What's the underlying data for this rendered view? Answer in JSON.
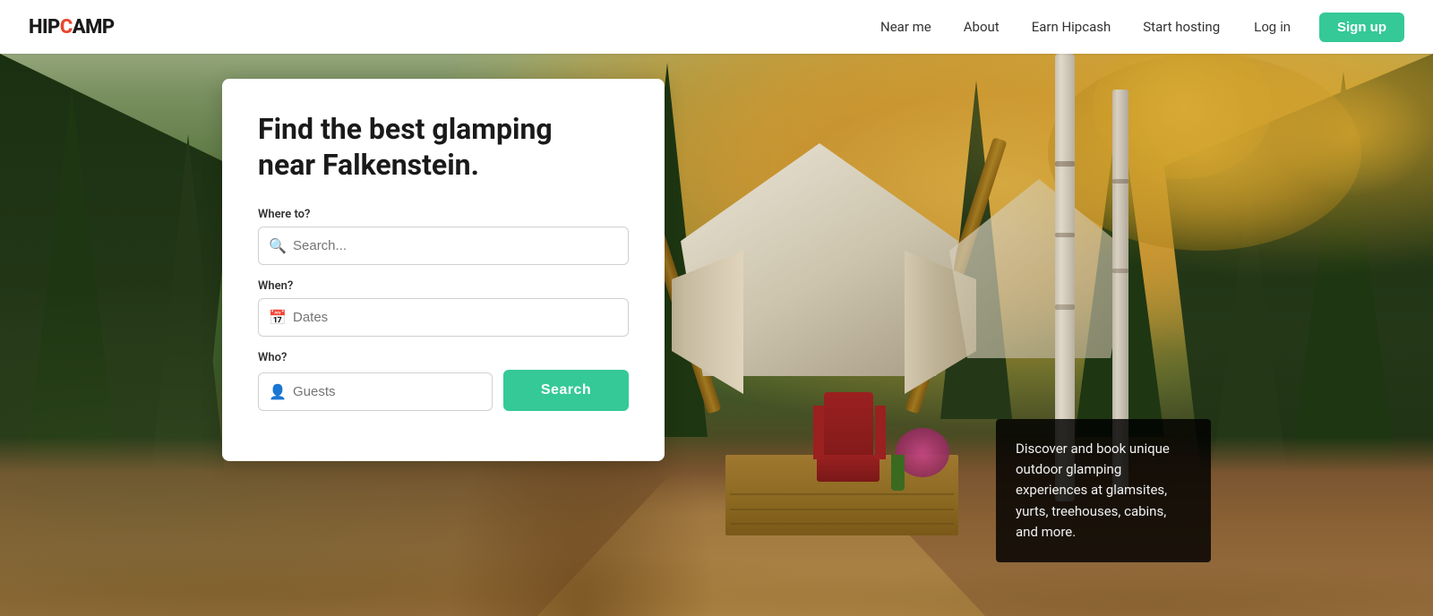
{
  "header": {
    "logo": "HIPCAMP",
    "nav": {
      "near_me": "Near me",
      "about": "About",
      "earn": "Earn Hipcash",
      "hosting": "Start hosting",
      "login": "Log in",
      "signup": "Sign up"
    }
  },
  "hero": {
    "headline_line1": "Find the best glamping",
    "headline_line2": "near Falkenstein."
  },
  "search_card": {
    "headline": "Find the best glamping near Falkenstein.",
    "where_label": "Where to?",
    "where_placeholder": "Search...",
    "when_label": "When?",
    "when_placeholder": "Dates",
    "who_label": "Who?",
    "who_placeholder": "Guests",
    "search_button": "Search"
  },
  "info_box": {
    "text": "Discover and book unique outdoor glamping experiences at glamsites, yurts, treehouses, cabins, and more."
  }
}
